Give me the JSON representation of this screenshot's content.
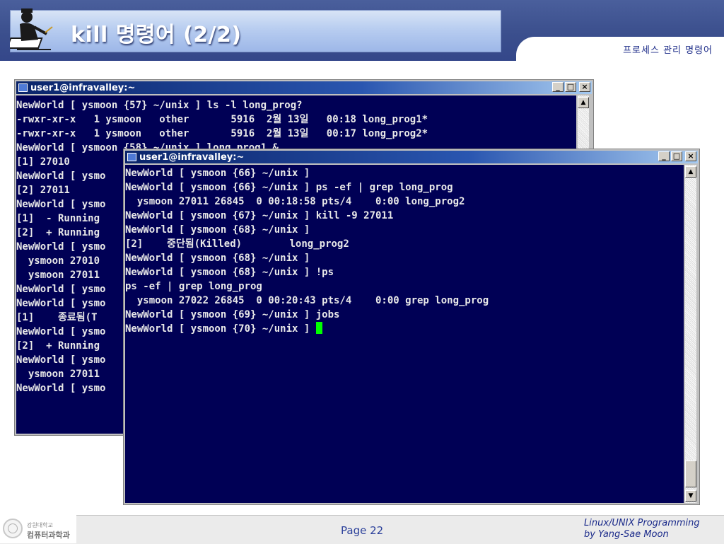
{
  "header": {
    "title": "kill 명령어 (2/2)",
    "section": "프로세스 관리 명령어"
  },
  "back_window": {
    "title": "user1@infravalley:~",
    "controls": [
      "_",
      "□",
      "×"
    ],
    "lines": [
      "NewWorld [ ysmoon {57} ~/unix ] ls -l long_prog?",
      "-rwxr-xr-x   1 ysmoon   other       5916  2월 13일   00:18 long_prog1*",
      "-rwxr-xr-x   1 ysmoon   other       5916  2월 13일   00:17 long_prog2*",
      "NewWorld [ ysmoon {58} ~/unix ] long_prog1 &",
      "[1] 27010",
      "NewWorld [ ysmo",
      "[2] 27011",
      "NewWorld [ ysmo",
      "[1]  - Running",
      "[2]  + Running",
      "NewWorld [ ysmo",
      "  ysmoon 27010",
      "  ysmoon 27011",
      "NewWorld [ ysmo",
      "NewWorld [ ysmo",
      "[1]    종료됨(T",
      "NewWorld [ ysmo",
      "[2]  + Running",
      "NewWorld [ ysmo",
      "  ysmoon 27011",
      "NewWorld [ ysmo"
    ]
  },
  "front_window": {
    "title": "user1@infravalley:~",
    "controls": [
      "_",
      "□",
      "×"
    ],
    "lines": [
      "NewWorld [ ysmoon {66} ~/unix ]",
      "NewWorld [ ysmoon {66} ~/unix ] ps -ef | grep long_prog",
      "  ysmoon 27011 26845  0 00:18:58 pts/4    0:00 long_prog2",
      "NewWorld [ ysmoon {67} ~/unix ] kill -9 27011",
      "NewWorld [ ysmoon {68} ~/unix ]",
      "[2]    중단됨(Killed)        long_prog2",
      "NewWorld [ ysmoon {68} ~/unix ]",
      "NewWorld [ ysmoon {68} ~/unix ] !ps",
      "ps -ef | grep long_prog",
      "  ysmoon 27022 26845  0 00:20:43 pts/4    0:00 grep long_prog",
      "NewWorld [ ysmoon {69} ~/unix ] jobs",
      "NewWorld [ ysmoon {70} ~/unix ] "
    ]
  },
  "footer": {
    "org_line1": "강원대학교",
    "org_line2": "컴퓨터과학과",
    "page": "Page 22",
    "credit_line1": "Linux/UNIX Programming",
    "credit_line2": "by Yang-Sae Moon"
  },
  "colors": {
    "terminal_bg": "#000055",
    "terminal_fg": "#e8e8e8",
    "cursor": "#00ff00",
    "header_band": "#3b4f8d",
    "title_bar": "#0a246a"
  },
  "icons": [
    "writer-at-desk-icon",
    "terminal-window-icon",
    "minimize-icon",
    "maximize-icon",
    "close-icon",
    "scroll-up-icon",
    "scroll-down-icon",
    "university-seal-icon"
  ]
}
